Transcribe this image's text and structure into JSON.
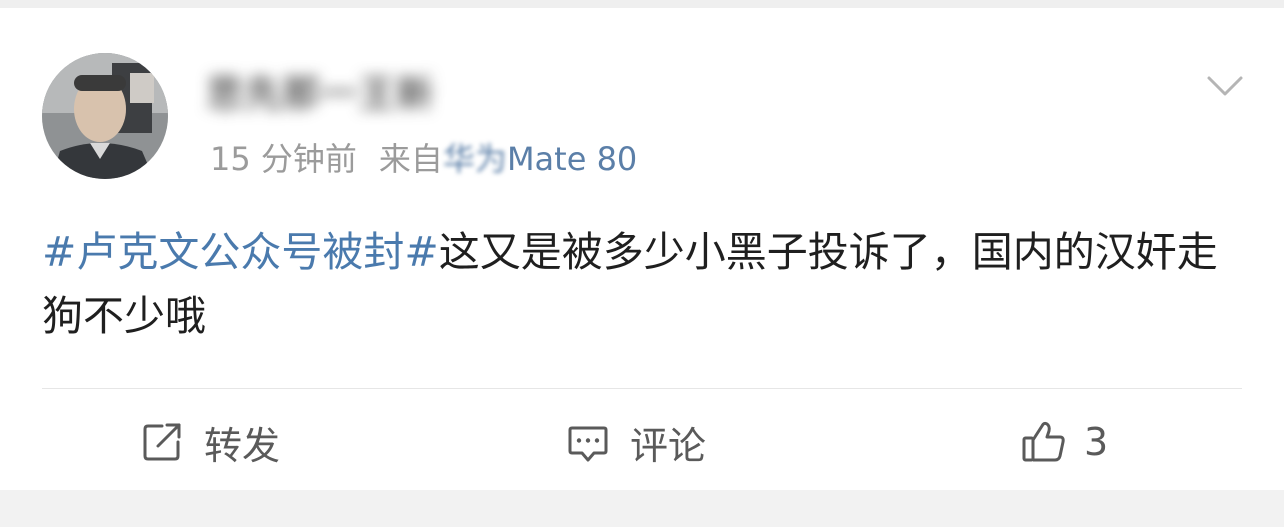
{
  "post": {
    "username": "思先那一王新",
    "time": "15 分钟前",
    "source_prefix": "来自",
    "source_device_blurred": "华为",
    "source_device": "Mate 80",
    "topic": "#卢克文公众号被封#",
    "body": "这又是被多少小黑子投诉了，国内的汉奸走狗不少哦"
  },
  "actions": {
    "repost_label": "转发",
    "comment_label": "评论",
    "like_count": "3"
  },
  "icons": {
    "more": "chevron-down-icon",
    "repost": "repost-icon",
    "comment": "comment-icon",
    "like": "thumbs-up-icon"
  },
  "colors": {
    "topic": "#4a7aad",
    "meta": "#9b9b9b",
    "device": "#5b7fa8",
    "text": "#1f1f1f"
  }
}
